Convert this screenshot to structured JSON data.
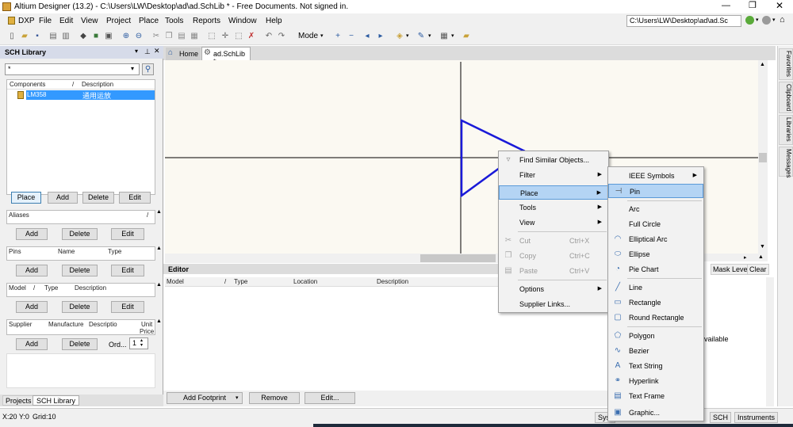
{
  "window": {
    "title": "Altium Designer (13.2) - C:\\Users\\LW\\Desktop\\ad\\ad.SchLib * - Free Documents. Not signed in.",
    "path": "C:\\Users\\LW\\Desktop\\ad\\ad.Sc"
  },
  "menubar": [
    "DXP",
    "File",
    "Edit",
    "View",
    "Project",
    "Place",
    "Tools",
    "Reports",
    "Window",
    "Help"
  ],
  "toolbar": {
    "mode_label": "Mode"
  },
  "tabs": {
    "home": "Home",
    "doc": "ad.SchLib *"
  },
  "sch_panel": {
    "title": "SCH Library",
    "filter_value": "*",
    "components_header": "Components",
    "description_header": "Description",
    "component_name": "LM358",
    "component_desc": "通用运放",
    "place_btn": "Place",
    "add_btn": "Add",
    "delete_btn": "Delete",
    "edit_btn": "Edit",
    "aliases_label": "Aliases",
    "pins_label": "Pins",
    "name_label": "Name",
    "type_label": "Type",
    "model_label": "Model",
    "model_type_label": "Type",
    "model_desc_label": "Description",
    "supplier_label": "Supplier",
    "manufacturer_label": "Manufacture",
    "supplier_desc_label": "Descriptio",
    "unit_label": "Unit",
    "price_label": "Price",
    "order_label": "Ord...",
    "order_value": "1",
    "bottom_tab_projects": "Projects",
    "bottom_tab_sch": "SCH Library"
  },
  "editor": {
    "label": "Editor",
    "col_model": "Model",
    "col_type": "Type",
    "col_location": "Location",
    "col_description": "Description",
    "add_footprint": "Add Footprint",
    "remove": "Remove",
    "edit": "Edit...",
    "mask_level": "Mask Level",
    "clear": "Clear",
    "partial_text": "vailable"
  },
  "right_tabs": [
    "Favorites",
    "Clipboard",
    "Libraries",
    "Messages"
  ],
  "statusbar": {
    "coords": "X:20 Y:0",
    "grid": "Grid:10",
    "syst": "Syst",
    "sch": "SCH",
    "instruments": "Instruments"
  },
  "context_menu": {
    "find_similar": "Find Similar Objects...",
    "filter": "Filter",
    "place": "Place",
    "tools": "Tools",
    "view": "View",
    "cut": "Cut",
    "cut_sc": "Ctrl+X",
    "copy": "Copy",
    "copy_sc": "Ctrl+C",
    "paste": "Paste",
    "paste_sc": "Ctrl+V",
    "options": "Options",
    "supplier_links": "Supplier Links..."
  },
  "place_submenu": {
    "ieee": "IEEE Symbols",
    "pin": "Pin",
    "arc": "Arc",
    "full_circle": "Full Circle",
    "elliptical_arc": "Elliptical Arc",
    "ellipse": "Ellipse",
    "pie_chart": "Pie Chart",
    "line": "Line",
    "rectangle": "Rectangle",
    "round_rectangle": "Round Rectangle",
    "polygon": "Polygon",
    "bezier": "Bezier",
    "text_string": "Text String",
    "hyperlink": "Hyperlink",
    "text_frame": "Text Frame",
    "graphic": "Graphic..."
  },
  "colors": {
    "symbol_blue": "#1a1ad8",
    "highlight": "#b4d4f4",
    "selection": "#3399ff"
  }
}
